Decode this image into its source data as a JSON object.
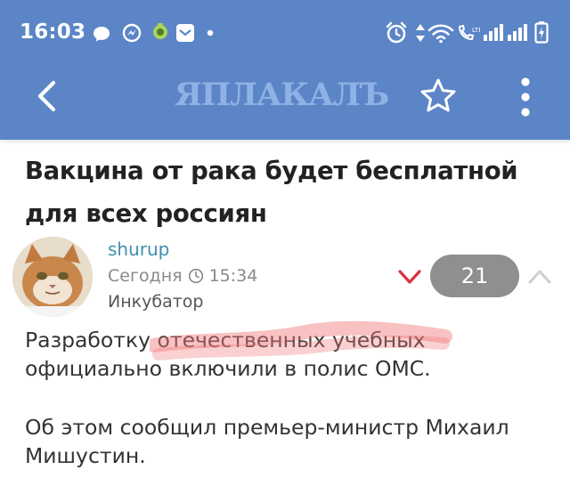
{
  "status_bar": {
    "time": "16:03",
    "icons": [
      "chat-bubble-icon",
      "messenger-icon",
      "app-notification-icon",
      "mail-icon",
      "more-dot-icon",
      "alarm-icon",
      "data-arrows-icon",
      "wifi-icon",
      "call-icon",
      "signal-icon",
      "signal-icon-2",
      "battery-icon"
    ]
  },
  "toolbar": {
    "logo": "ЯПЛАКАЛЪ",
    "back_icon": "arrow-left-icon",
    "favorite_icon": "star-outline-icon",
    "menu_icon": "more-vertical-icon",
    "background_color": "#5b85c6"
  },
  "article": {
    "title": "Вакцина от рака будет бесплатной для всех россиян"
  },
  "post": {
    "author": "shurup",
    "time": "Сегодня",
    "time_value": "15:34",
    "rank": "Инкубатор",
    "rating": "21",
    "body": [
      "Разработку отечественных учебных официально включили в полис ОМС.",
      "Об этом сообщил премьер-министр Михаил Мишустин."
    ]
  },
  "colors": {
    "author_link": "#3f8fae",
    "downvote": "#d9323e",
    "rating_pill": "#8f8f8f",
    "highlight": "#f07878"
  }
}
